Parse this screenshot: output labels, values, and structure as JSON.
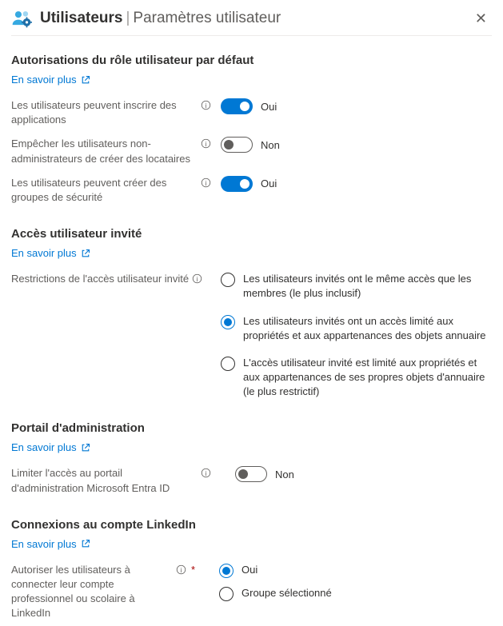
{
  "header": {
    "title": "Utilisateurs",
    "subtitle": "Paramètres utilisateur"
  },
  "learn_more_label": "En savoir plus",
  "toggle_labels": {
    "on": "Oui",
    "off": "Non"
  },
  "sections": {
    "default_role": {
      "title": "Autorisations du rôle utilisateur par défaut",
      "rows": {
        "register_apps": {
          "label": "Les utilisateurs peuvent inscrire des applications",
          "value": true
        },
        "prevent_non_admin_tenant": {
          "label": "Empêcher les utilisateurs non-administrateurs de créer des locataires",
          "value": false
        },
        "create_security_groups": {
          "label": "Les utilisateurs peuvent créer des groupes de sécurité",
          "value": true
        }
      }
    },
    "guest_access": {
      "title": "Accès utilisateur invité",
      "row_label": "Restrictions de l'accès utilisateur invité",
      "options": [
        "Les utilisateurs invités ont le même accès que les membres (le plus inclusif)",
        "Les utilisateurs invités ont un accès limité aux propriétés et aux appartenances des objets annuaire",
        "L'accès utilisateur invité est limité aux propriétés et aux appartenances de ses propres objets d'annuaire (le plus restrictif)"
      ],
      "selected": 1
    },
    "admin_portal": {
      "title": "Portail d'administration",
      "row": {
        "label": "Limiter l'accès au portail d'administration Microsoft Entra ID",
        "value": false
      }
    },
    "linkedin": {
      "title": "Connexions au compte LinkedIn",
      "row_label": "Autoriser les utilisateurs à connecter leur compte professionnel ou scolaire à LinkedIn",
      "options": [
        "Oui",
        "Groupe sélectionné"
      ],
      "selected": 0
    }
  }
}
